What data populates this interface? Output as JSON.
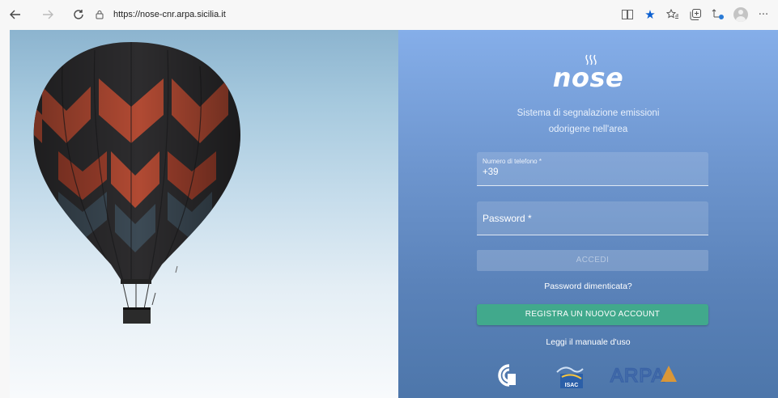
{
  "browser": {
    "url": "https://nose-cnr.arpa.sicilia.it",
    "icons": [
      "back-arrow-icon",
      "forward-arrow-icon",
      "refresh-icon",
      "lock-icon",
      "reader-mode-icon",
      "favorite-star-icon",
      "favorites-list-icon",
      "collections-icon",
      "extension-icon",
      "profile-avatar-icon",
      "more-menu-icon"
    ]
  },
  "login": {
    "logo_text": "nose",
    "subtitle_line1": "Sistema di segnalazione emissioni",
    "subtitle_line2": "odorigene nell'area",
    "phone_label": "Numero di telefono *",
    "phone_value": "+39",
    "password_placeholder": "Password *",
    "login_button": "ACCEDI",
    "forgot_password": "Password dimenticata?",
    "register_button": "REGISTRA UN NUOVO ACCOUNT",
    "manual_link": "Leggi il manuale d'uso"
  },
  "partners": {
    "cnr_logo": "cnr-logo",
    "isac_text": "ISAC",
    "arpa_text": "ARPA"
  },
  "colors": {
    "register_green": "#41a98c",
    "panel_blue_top": "#85aee9",
    "panel_blue_bottom": "#4d76aa",
    "arpa_blue": "#3a63a6",
    "arpa_orange": "#e99a2b"
  }
}
